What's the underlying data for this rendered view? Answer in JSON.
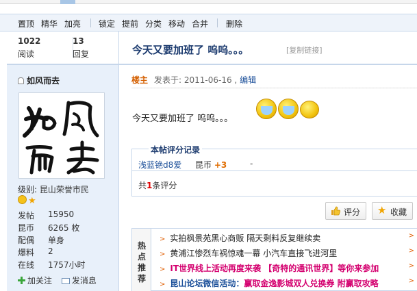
{
  "toolbar": {
    "items": [
      "置顶",
      "精华",
      "加亮",
      "锁定",
      "提前",
      "分类",
      "移动",
      "合并",
      "删除"
    ]
  },
  "stats": {
    "views_value": "1022",
    "views_label": "阅读",
    "replies_value": "13",
    "replies_label": "回复"
  },
  "thread": {
    "title": "今天又要加班了  呜呜。。。",
    "copy_link": "[复制链接]"
  },
  "author": {
    "name": "如风而去",
    "level_label": "级别:",
    "level_value": "昆山荣誉市民",
    "info": [
      {
        "key": "发帖",
        "value": "15950"
      },
      {
        "key": "昆币",
        "value": "6265 枚"
      },
      {
        "key": "配偶",
        "value": "单身"
      },
      {
        "key": "爆料",
        "value": "2"
      },
      {
        "key": "在线",
        "value": "1757小时"
      }
    ],
    "follow_label": "加关注",
    "message_label": "发消息"
  },
  "post": {
    "floor_label": "楼主",
    "posted_text": "发表于: 2011-06-16 ,",
    "edit_label": "编辑",
    "body": "今天又要加班了  呜呜。。。"
  },
  "rating": {
    "title": "本帖评分记录",
    "user": "浅蓝铯d8爱",
    "item": "昆币",
    "amount": "+3",
    "dash": "-",
    "count_prefix": "共",
    "count_value": "1",
    "count_suffix": "条评分"
  },
  "buttons": {
    "rate_label": "评分",
    "favorite_label": "收藏"
  },
  "hot": {
    "label_chars": [
      "热",
      "点",
      "推",
      "荐"
    ],
    "items": [
      {
        "text": "实拍枫景苑黑心商贩 隔天剩料反复继续卖"
      },
      {
        "text": "黄浦江惨烈车祸惊魂一幕 小汽车直接飞进河里"
      },
      {
        "text": "IT世界线上活动再度来袭 【奇特的通讯世界】等你来参加"
      },
      {
        "text_a": "昆山论坛微信活动：",
        "text_b": "赢取金逸影城双人兑换券 附赢取攻略"
      }
    ]
  },
  "colors": {
    "toolbar_bg": "#eef3fa",
    "profile_bg": "#e8f0fa",
    "title_color": "#1b3a6e",
    "floor_color": "#d45f00",
    "pink_link": "#d4006f"
  }
}
